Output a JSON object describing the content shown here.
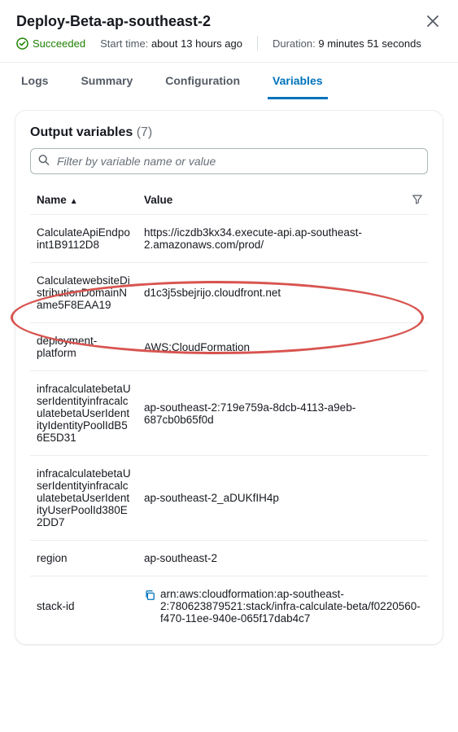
{
  "header": {
    "title": "Deploy-Beta-ap-southeast-2",
    "status_label": "Succeeded",
    "start_label": "Start time:",
    "start_value": "about 13 hours ago",
    "duration_label": "Duration:",
    "duration_value": "9 minutes 51 seconds"
  },
  "tabs": {
    "logs": "Logs",
    "summary": "Summary",
    "configuration": "Configuration",
    "variables": "Variables"
  },
  "card": {
    "title": "Output variables",
    "count": "(7)",
    "filter_placeholder": "Filter by variable name or value",
    "col_name": "Name",
    "col_value": "Value"
  },
  "rows": [
    {
      "name": "CalculateApiEndpoint1B9112D8",
      "value": "https://iczdb3kx34.execute-api.ap-southeast-2.amazonaws.com/prod/"
    },
    {
      "name": "CalculatewebsiteDistributionDomainName5F8EAA19",
      "value": "d1c3j5sbejrijo.cloudfront.net"
    },
    {
      "name": "deployment-platform",
      "value": "AWS:CloudFormation"
    },
    {
      "name": "infracalculatebetaUserIdentityinfracalculatebetaUserIdentityIdentityPoolIdB56E5D31",
      "value": "ap-southeast-2:719e759a-8dcb-4113-a9eb-687cb0b65f0d"
    },
    {
      "name": "infracalculatebetaUserIdentityinfracalculatebetaUserIdentityUserPoolId380E2DD7",
      "value": "ap-southeast-2_aDUKfIH4p"
    },
    {
      "name": "region",
      "value": "ap-southeast-2"
    },
    {
      "name": "stack-id",
      "value": "arn:aws:cloudformation:ap-southeast-2:780623879521:stack/infra-calculate-beta/f0220560-f470-11ee-940e-065f17dab4c7"
    }
  ]
}
